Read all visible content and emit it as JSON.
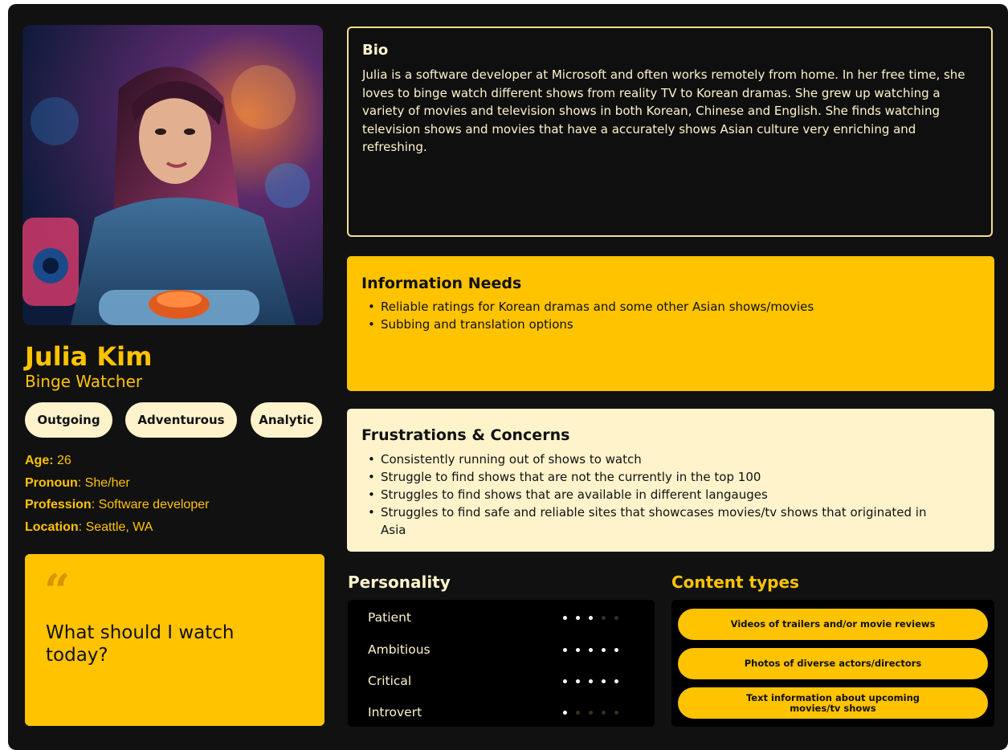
{
  "persona": {
    "name": "Julia Kim",
    "role": "Binge Watcher",
    "traits": [
      "Outgoing",
      "Adventurous",
      "Analytic"
    ],
    "facts": [
      {
        "label": "Age:",
        "value": " 26"
      },
      {
        "label": "Pronoun",
        "value": ": She/her"
      },
      {
        "label": "Profession",
        "value": ": Software developer"
      },
      {
        "label": "Location",
        "value": ": Seattle, WA"
      }
    ],
    "quote_mark": "“",
    "quote": "What should I watch today?"
  },
  "bio": {
    "title": "Bio",
    "text": "Julia is a software developer at Microsoft and often works remotely from home. In her free time, she loves to binge watch different shows from reality TV to Korean dramas. She grew up watching a variety of movies and television shows in both Korean, Chinese and English. She finds watching television shows and movies that have a accurately shows Asian culture very enriching and refreshing."
  },
  "information_needs": {
    "title": "Information Needs",
    "items": [
      "Reliable ratings for Korean dramas and some other Asian shows/movies",
      "Subbing and translation options"
    ]
  },
  "frustrations": {
    "title": "Frustrations & Concerns",
    "items": [
      "Consistently running out of shows to watch",
      "Struggle to find shows that are not the currently in the top 100",
      "Struggles to find shows that are available in different langauges",
      "Struggles to find safe and reliable sites that showcases movies/tv shows that originated in Asia"
    ]
  },
  "personality": {
    "title": "Personality",
    "rows": [
      {
        "label": "Patient",
        "level": 3,
        "max": 5
      },
      {
        "label": "Ambitious",
        "level": 5,
        "max": 5
      },
      {
        "label": "Critical",
        "level": 5,
        "max": 5
      },
      {
        "label": "Introvert",
        "level": 1,
        "max": 5
      }
    ]
  },
  "content_types": {
    "title": "Content types",
    "items": [
      "Videos of trailers and/or movie reviews",
      "Photos of diverse actors/directors",
      "Text information about upcoming movies/tv shows"
    ]
  },
  "colors": {
    "accent": "#ffc300",
    "cream": "#fff3cc",
    "background": "#111111"
  }
}
